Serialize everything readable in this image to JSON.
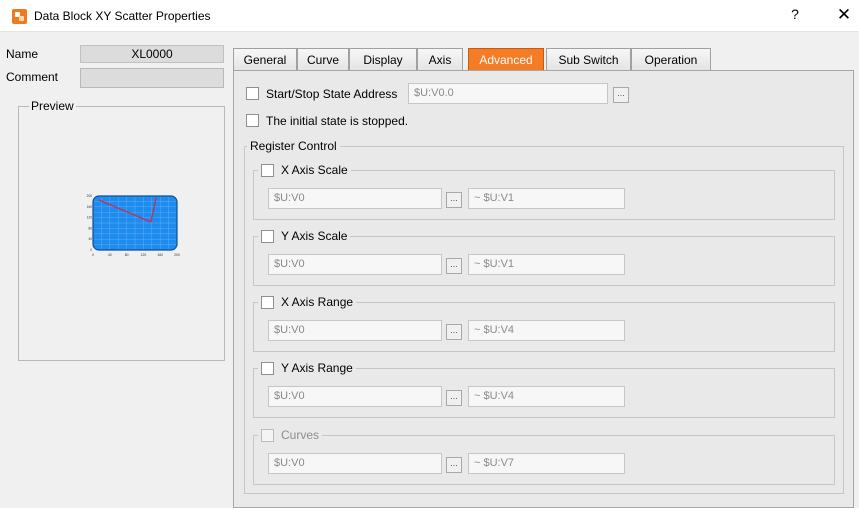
{
  "window": {
    "title": "Data Block XY Scatter Properties",
    "help_label": "?",
    "close_label": "✕"
  },
  "left": {
    "name_label": "Name",
    "name_value": "XL0000",
    "comment_label": "Comment",
    "comment_value": "",
    "preview_label": "Preview",
    "preview_x_ticks": [
      "0",
      "20",
      "40",
      "60",
      "80",
      "100",
      "120",
      "140",
      "160",
      "180",
      "200"
    ],
    "preview_y_ticks": [
      "200",
      "180",
      "160",
      "140",
      "120",
      "100",
      "80",
      "60",
      "40",
      "20",
      "0"
    ]
  },
  "tabs": [
    {
      "label": "General",
      "active": false
    },
    {
      "label": "Curve",
      "active": false
    },
    {
      "label": "Display",
      "active": false
    },
    {
      "label": "Axis",
      "active": false
    },
    {
      "label": "Advanced",
      "active": true
    },
    {
      "label": "Sub Switch",
      "active": false
    },
    {
      "label": "Operation",
      "active": false
    }
  ],
  "advanced": {
    "start_stop": {
      "label": "Start/Stop State Address",
      "value": "$U:V0.0",
      "checked": false
    },
    "initial_stopped": {
      "label": "The initial state is stopped.",
      "checked": false
    },
    "register_control_label": "Register Control",
    "groups": [
      {
        "label": "X Axis Scale",
        "from": "$U:V0",
        "to": "~ $U:V1",
        "checked": false,
        "enabled": true
      },
      {
        "label": "Y Axis Scale",
        "from": "$U:V0",
        "to": "~ $U:V1",
        "checked": false,
        "enabled": true
      },
      {
        "label": "X Axis Range",
        "from": "$U:V0",
        "to": "~ $U:V4",
        "checked": false,
        "enabled": true
      },
      {
        "label": "Y Axis Range",
        "from": "$U:V0",
        "to": "~ $U:V4",
        "checked": false,
        "enabled": true
      },
      {
        "label": "Curves",
        "from": "$U:V0",
        "to": "~ $U:V7",
        "checked": false,
        "enabled": false
      }
    ]
  },
  "icons": {
    "app": "app-icon",
    "browse": "ellipsis-icon"
  },
  "colors": {
    "active_tab": "#f57c26",
    "preview_plot": "#1e8bef",
    "preview_line": "#c4304d"
  }
}
